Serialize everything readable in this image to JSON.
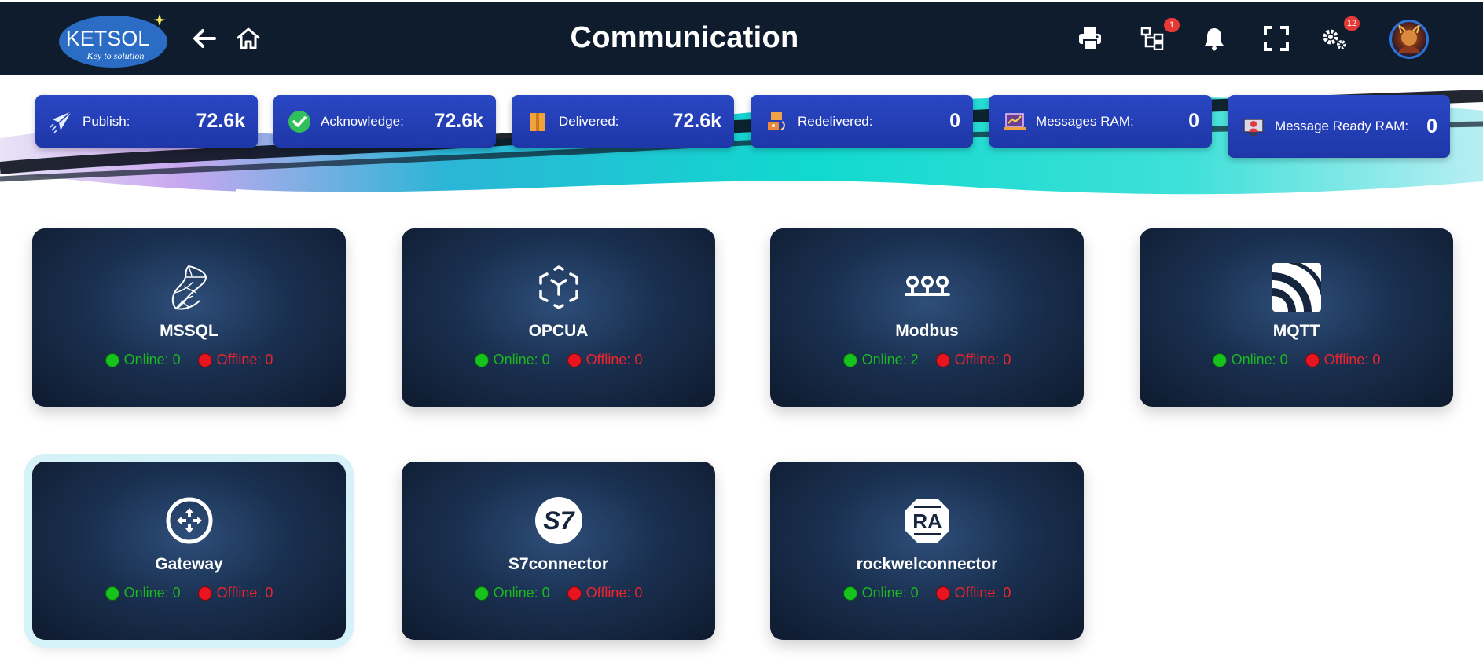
{
  "header": {
    "logo_text": "KETSOL",
    "logo_tagline": "Key to solution",
    "title": "Communication",
    "network_badge": "1",
    "settings_badge": "12"
  },
  "icons": {
    "back": "arrow-left-icon",
    "home": "home-icon",
    "print": "printer-icon",
    "network": "network-icon",
    "notifications": "bell-icon",
    "fullscreen": "fullscreen-icon",
    "settings": "gears-icon"
  },
  "stats": [
    {
      "label": "Publish:",
      "value": "72.6k",
      "icon": "paper-plane-icon"
    },
    {
      "label": "Acknowledge:",
      "value": "72.6k",
      "icon": "check-circle-icon"
    },
    {
      "label": "Delivered:",
      "value": "72.6k",
      "icon": "box-icon"
    },
    {
      "label": "Redelivered:",
      "value": "0",
      "icon": "redelivery-icon"
    },
    {
      "label": "Messages RAM:",
      "value": "0",
      "icon": "laptop-chart-icon"
    },
    {
      "label": "Message Ready RAM:",
      "value": "0",
      "icon": "monitor-user-icon"
    }
  ],
  "connectors": [
    {
      "name": "MSSQL",
      "online": "Online: 0",
      "offline": "Offline: 0",
      "icon": "mssql-icon"
    },
    {
      "name": "OPCUA",
      "online": "Online: 0",
      "offline": "Offline: 0",
      "icon": "opcua-icon"
    },
    {
      "name": "Modbus",
      "online": "Online: 2",
      "offline": "Offline: 0",
      "icon": "modbus-icon"
    },
    {
      "name": "MQTT",
      "online": "Online: 0",
      "offline": "Offline: 0",
      "icon": "mqtt-icon"
    },
    {
      "name": "Gateway",
      "online": "Online: 0",
      "offline": "Offline: 0",
      "icon": "gateway-icon"
    },
    {
      "name": "S7connector",
      "online": "Online: 0",
      "offline": "Offline: 0",
      "icon": "s7-icon"
    },
    {
      "name": "rockwelconnector",
      "online": "Online: 0",
      "offline": "Offline: 0",
      "icon": "rockwell-icon"
    }
  ],
  "colors": {
    "header_bg": "#0f1c2e",
    "stat_bg": "#2340b8",
    "online": "#16c21b",
    "offline": "#e8141f",
    "badge": "#e53935",
    "selected_outline": "#d4f2f8"
  }
}
